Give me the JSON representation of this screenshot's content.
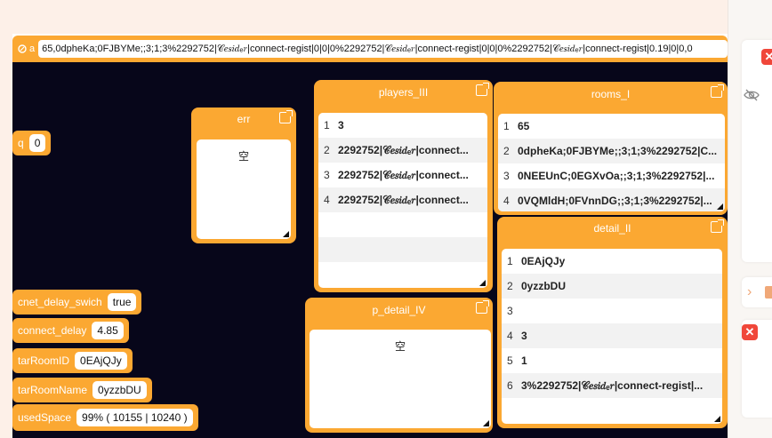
{
  "topbar": {
    "label": "a",
    "value": "65,0dpheKa;0FJBYMe;;3;1;3%2292752|𝒞𝑒𝑠𝑖𝑑ₑ𝑟|connect-regist|0|0|0%2292752|𝒞𝑒𝑠𝑖𝑑ₑ𝑟|connect-regist|0|0|0%2292752|𝒞𝑒𝑠𝑖𝑑ₑ𝑟|connect-regist|0.19|0|0,0"
  },
  "vars": {
    "q": {
      "label": "q",
      "value": "0"
    },
    "cnet_delay_swich": {
      "label": "cnet_delay_swich",
      "value": "true"
    },
    "connect_delay": {
      "label": "connect_delay",
      "value": "4.85"
    },
    "tarRoomID": {
      "label": "tarRoomID",
      "value": "0EAjQJy"
    },
    "tarRoomName": {
      "label": "tarRoomName",
      "value": "0yzzbDU"
    },
    "usedSpace": {
      "label": "usedSpace",
      "value": "99% ( 10155 | 10240 )"
    }
  },
  "panels": {
    "err": {
      "title": "err",
      "empty": "空"
    },
    "p_detail_IV": {
      "title": "p_detail_IV",
      "empty": "空"
    },
    "players_III": {
      "title": "players_III",
      "rows": [
        {
          "n": "1",
          "t": "3"
        },
        {
          "n": "2",
          "t": "2292752|𝒞𝑒𝑠𝑖𝑑ₑ𝑟|connect..."
        },
        {
          "n": "3",
          "t": "2292752|𝒞𝑒𝑠𝑖𝑑ₑ𝑟|connect..."
        },
        {
          "n": "4",
          "t": "2292752|𝒞𝑒𝑠𝑖𝑑ₑ𝑟|connect..."
        },
        {
          "n": "",
          "t": ""
        },
        {
          "n": "",
          "t": ""
        }
      ]
    },
    "rooms_I": {
      "title": "rooms_I",
      "rows": [
        {
          "n": "1",
          "t": "65"
        },
        {
          "n": "2",
          "t": "0dpheKa;0FJBYMe;;3;1;3%2292752|C..."
        },
        {
          "n": "3",
          "t": "0NEEUnC;0EGXvOa;;3;1;3%2292752|..."
        },
        {
          "n": "4",
          "t": "0VQMldH;0FVnnDG;;3;1;3%2292752|..."
        }
      ]
    },
    "detail_II": {
      "title": "detail_II",
      "rows": [
        {
          "n": "1",
          "t": "0EAjQJy"
        },
        {
          "n": "2",
          "t": "0yzzbDU"
        },
        {
          "n": "3",
          "t": ""
        },
        {
          "n": "4",
          "t": "3"
        },
        {
          "n": "5",
          "t": "1"
        },
        {
          "n": "6",
          "t": "3%2292752|𝒞𝑒𝑠𝑖𝑑ₑ𝑟|connect-regist|..."
        }
      ]
    }
  },
  "colors": {
    "accent": "#fba832",
    "stage": "#07061a",
    "alert": "#f0473a"
  },
  "icons": [
    "edit-icon",
    "open-external-icon",
    "resize-handle-icon",
    "eye-off-icon",
    "close-icon",
    "chevron-right-icon"
  ]
}
